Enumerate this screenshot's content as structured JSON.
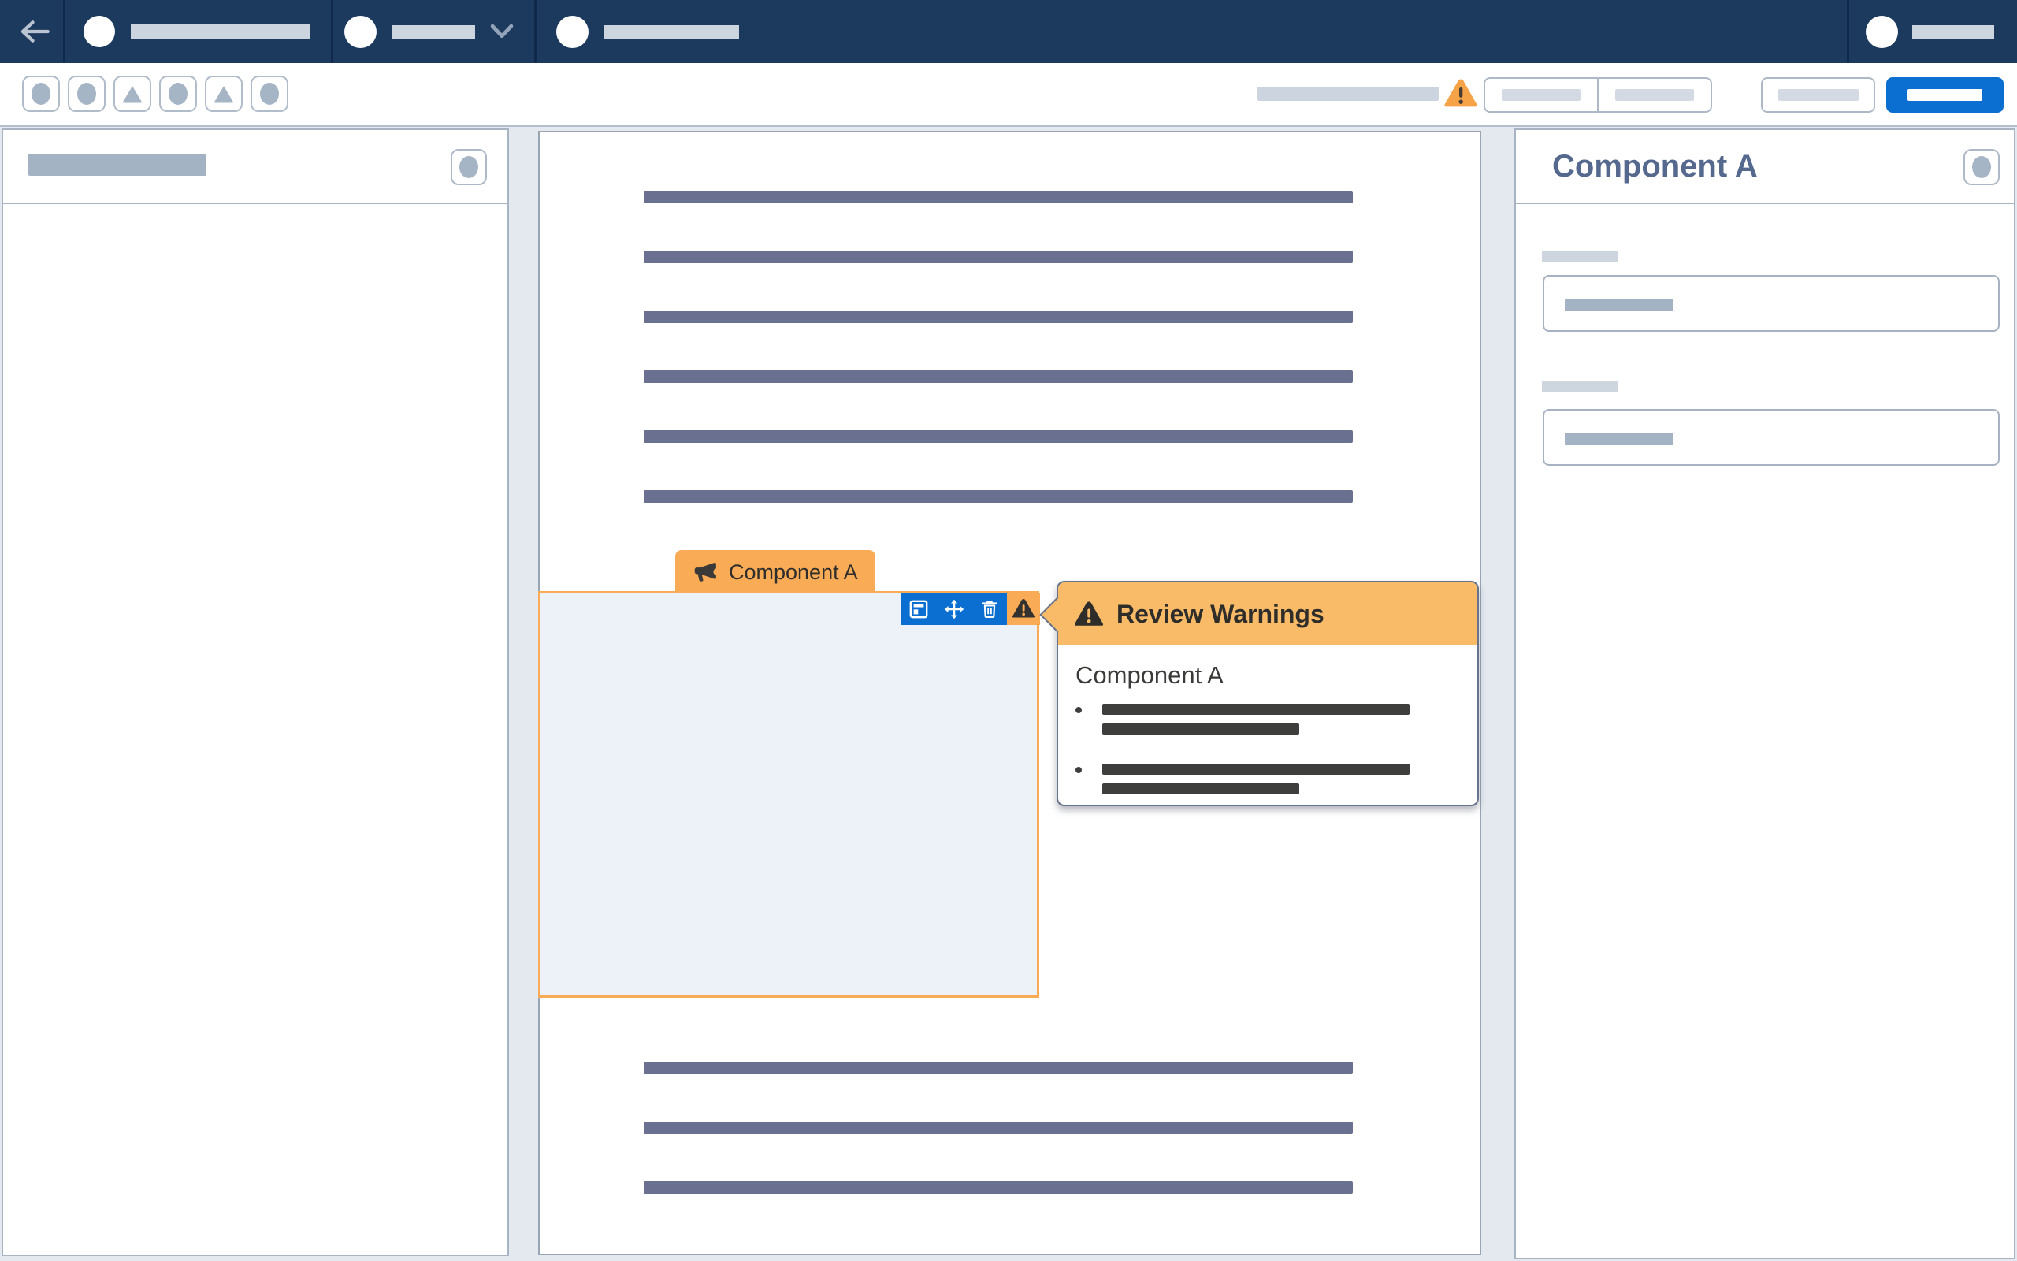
{
  "colors": {
    "navbar_bg": "#1C3A5E",
    "accent_blue": "#0B6FD2",
    "warning_orange": "#F9AB55",
    "popover_header_orange": "#F9BB68",
    "page_bg": "#E4E8EF",
    "skeleton_slate": "#6A7090",
    "skeleton_dark": "#3E3E3C",
    "inspector_title_color": "#54698D"
  },
  "navbar": {
    "back_icon": "arrow-left-icon",
    "menus": [
      {
        "avatar": "circle-avatar",
        "has_chevron": false
      },
      {
        "avatar": "circle-avatar",
        "has_chevron": true,
        "chevron_icon": "chevron-down-icon"
      },
      {
        "avatar": "circle-avatar",
        "has_chevron": false
      }
    ],
    "user_menu": {
      "avatar": "circle-avatar"
    }
  },
  "toolbar": {
    "left_buttons": [
      {
        "icon": "circle-icon"
      },
      {
        "icon": "circle-icon"
      },
      {
        "icon": "triangle-icon"
      },
      {
        "icon": "circle-icon"
      },
      {
        "icon": "triangle-icon"
      },
      {
        "icon": "circle-icon"
      }
    ],
    "status": {
      "warning_icon": "warning-triangle-icon"
    },
    "segmented_button_count": 2,
    "has_secondary_button": true,
    "has_primary_button": true
  },
  "sidebar": {
    "header_button_icon": "circle-icon"
  },
  "canvas": {
    "top_skeleton_line_count": 6,
    "bottom_skeleton_line_count": 3
  },
  "component": {
    "tag": {
      "icon": "megaphone-icon",
      "label": "Component A"
    },
    "toolbar_icons": [
      "layout-icon",
      "move-icon",
      "trash-icon",
      "warning-triangle-icon"
    ]
  },
  "popover": {
    "icon": "warning-triangle-icon",
    "title": "Review Warnings",
    "body": {
      "heading": "Component A",
      "bullet_count": 2
    }
  },
  "inspector": {
    "title": "Component A",
    "header_button_icon": "circle-icon",
    "field_count": 2
  }
}
